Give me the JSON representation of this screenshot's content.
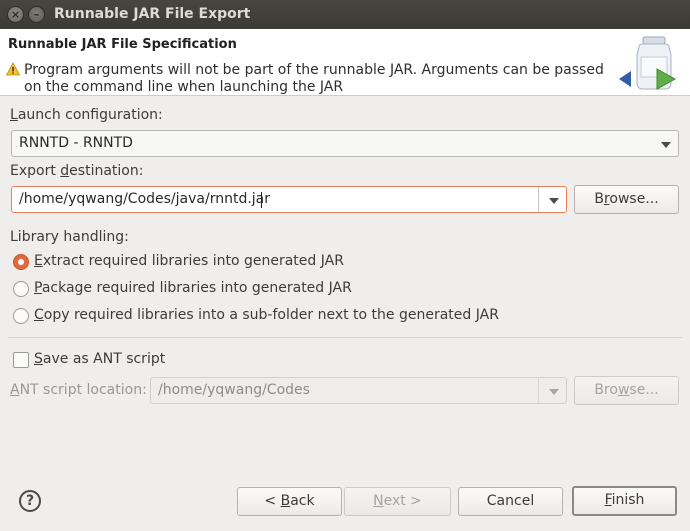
{
  "window": {
    "title": "Runnable JAR File Export"
  },
  "banner": {
    "title": "Runnable JAR File Specification",
    "message": "Program arguments will not be part of the runnable JAR. Arguments can be passed on the command line when launching the JAR"
  },
  "launch_configuration": {
    "label_before": "",
    "label_key": "L",
    "label_after": "aunch configuration:",
    "value": "RNNTD - RNNTD"
  },
  "export_destination": {
    "label_before": "Export ",
    "label_key": "d",
    "label_after": "estination:",
    "value": "/home/yqwang/Codes/java/rnntd.jar",
    "browse": {
      "before": "B",
      "key": "r",
      "after": "owse..."
    }
  },
  "library_handling": {
    "label": "Library handling:",
    "options": [
      {
        "before": "",
        "key": "E",
        "after": "xtract required libraries into generated JAR",
        "selected": true
      },
      {
        "before": "",
        "key": "P",
        "after": "ackage required libraries into generated JAR",
        "selected": false
      },
      {
        "before": "",
        "key": "C",
        "after": "opy required libraries into a sub-folder next to the generated JAR",
        "selected": false
      }
    ]
  },
  "ant": {
    "save_before": "",
    "save_key": "S",
    "save_after": "ave as ANT script",
    "checked": false,
    "location_before": "",
    "location_key": "A",
    "location_after": "NT script location:",
    "location_value": "/home/yqwang/Codes",
    "browse": {
      "before": "Bro",
      "key": "w",
      "after": "se..."
    }
  },
  "footer": {
    "help": "?",
    "back": {
      "before": "< ",
      "key": "B",
      "after": "ack"
    },
    "next": {
      "before": "",
      "key": "N",
      "after": "ext >"
    },
    "cancel": "Cancel",
    "finish": {
      "before": "",
      "key": "F",
      "after": "inish"
    }
  },
  "colors": {
    "accent": "#e46a3e",
    "titlebar": "#3f3e39",
    "warning": "#f0c232"
  }
}
